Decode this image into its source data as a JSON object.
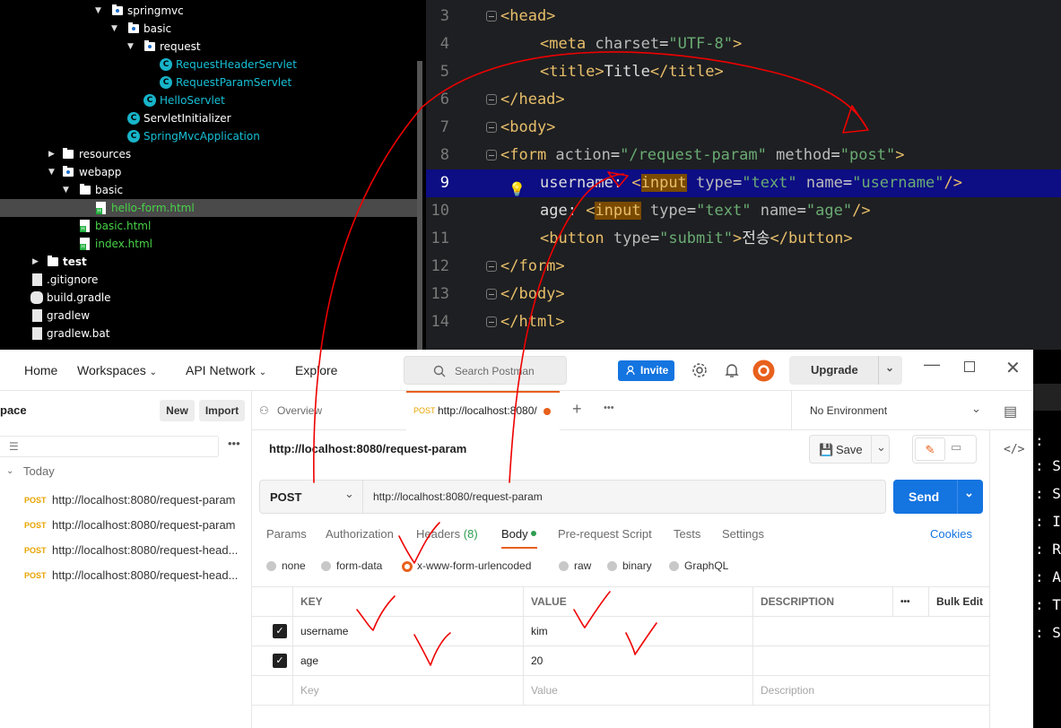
{
  "tree": {
    "items": [
      {
        "label": "springmvc",
        "kind": "folder",
        "color": "white"
      },
      {
        "label": "basic",
        "kind": "folder",
        "color": "white"
      },
      {
        "label": "request",
        "kind": "folder",
        "color": "white"
      },
      {
        "label": "RequestHeaderServlet",
        "kind": "class",
        "color": "cyan"
      },
      {
        "label": "RequestParamServlet",
        "kind": "class",
        "color": "cyan"
      },
      {
        "label": "HelloServlet",
        "kind": "class",
        "color": "cyan"
      },
      {
        "label": "ServletInitializer",
        "kind": "class",
        "color": "white"
      },
      {
        "label": "SpringMvcApplication",
        "kind": "class",
        "color": "cyan"
      },
      {
        "label": "resources",
        "kind": "folder",
        "color": "white"
      },
      {
        "label": "webapp",
        "kind": "folder",
        "color": "white"
      },
      {
        "label": "basic",
        "kind": "folder",
        "color": "white"
      },
      {
        "label": "hello-form.html",
        "kind": "html",
        "color": "green"
      },
      {
        "label": "basic.html",
        "kind": "html",
        "color": "green"
      },
      {
        "label": "index.html",
        "kind": "html",
        "color": "green"
      },
      {
        "label": "test",
        "kind": "folder",
        "color": "white"
      },
      {
        "label": ".gitignore",
        "kind": "file",
        "color": "white"
      },
      {
        "label": "build.gradle",
        "kind": "file",
        "color": "white"
      },
      {
        "label": "gradlew",
        "kind": "file",
        "color": "white"
      },
      {
        "label": "gradlew.bat",
        "kind": "file",
        "color": "white"
      }
    ]
  },
  "editor": {
    "line_numbers": [
      "3",
      "4",
      "5",
      "6",
      "7",
      "8",
      "9",
      "10",
      "11",
      "12",
      "13",
      "14"
    ],
    "lines": [
      {
        "t": "<head>"
      },
      {
        "a": "<meta ",
        "b": "charset",
        "c": "=",
        "d": "\"UTF-8\"",
        "e": ">"
      },
      {
        "a": "<title>",
        "b": "Title",
        "c": "</title>"
      },
      {
        "t": "</head>"
      },
      {
        "t": "<body>"
      },
      {
        "a": "<form ",
        "b": "action",
        "c": "=",
        "d": "\"/request-param\"",
        "e": " method",
        "f": "=",
        "g": "\"post\"",
        "h": ">"
      },
      {
        "a": "username: ",
        "b": "<",
        "c": "input",
        "d": " type",
        "e": "=",
        "f": "\"text\"",
        "g": " name",
        "h": "=",
        "i": "\"username\"",
        "j": "/>"
      },
      {
        "a": "age: ",
        "b": "<",
        "c": "input",
        "d": " type",
        "e": "=",
        "f": "\"text\"",
        "g": " name",
        "h": "=",
        "i": "\"age\"",
        "j": "/>"
      },
      {
        "a": "<button ",
        "b": "type",
        "c": "=",
        "d": "\"submit\"",
        "e": ">",
        "f": "전송",
        "g": "</button>"
      },
      {
        "t": "</form>"
      },
      {
        "t": "</body>"
      },
      {
        "t": "</html>"
      }
    ]
  },
  "terminal": {
    "chars": [
      ":",
      ":",
      ":",
      ":",
      ":",
      ":",
      ":",
      ":"
    ],
    "letters": [
      "",
      "S",
      "S",
      "I",
      "R",
      "A",
      "T",
      "S"
    ]
  },
  "postman": {
    "nav": {
      "home": "Home",
      "workspaces": "Workspaces",
      "api_network": "API Network",
      "explore": "Explore"
    },
    "search_placeholder": "Search Postman",
    "invite": "Invite",
    "upgrade": "Upgrade",
    "sidebar": {
      "title": "pace",
      "new": "New",
      "import": "Import",
      "group": "Today",
      "history": [
        {
          "method": "POST",
          "url": "http://localhost:8080/request-param"
        },
        {
          "method": "POST",
          "url": "http://localhost:8080/request-param"
        },
        {
          "method": "POST",
          "url": "http://localhost:8080/request-head..."
        },
        {
          "method": "POST",
          "url": "http://localhost:8080/request-head..."
        }
      ]
    },
    "tabs": {
      "overview": "Overview",
      "active_method": "POST",
      "active_url": "http://localhost:8080/",
      "env": "No Environment"
    },
    "request": {
      "title": "http://localhost:8080/request-param",
      "save": "Save",
      "method": "POST",
      "url": "http://localhost:8080/request-param",
      "send": "Send",
      "subtabs": [
        "Params",
        "Authorization",
        "Headers",
        "(8)",
        "Body",
        "Pre-request Script",
        "Tests",
        "Settings"
      ],
      "cookies": "Cookies",
      "body_types": [
        "none",
        "form-data",
        "x-www-form-urlencoded",
        "raw",
        "binary",
        "GraphQL"
      ],
      "columns": {
        "key": "KEY",
        "value": "VALUE",
        "description": "DESCRIPTION",
        "bulk": "Bulk Edit",
        "more": "•••"
      },
      "rows": [
        {
          "key": "username",
          "value": "kim",
          "checked": true
        },
        {
          "key": "age",
          "value": "20",
          "checked": true
        }
      ],
      "placeholders": {
        "key": "Key",
        "value": "Value",
        "description": "Description"
      }
    },
    "colors": {
      "accent": "#e8601c",
      "primary": "#1474e0",
      "post": "#e8a300"
    }
  }
}
